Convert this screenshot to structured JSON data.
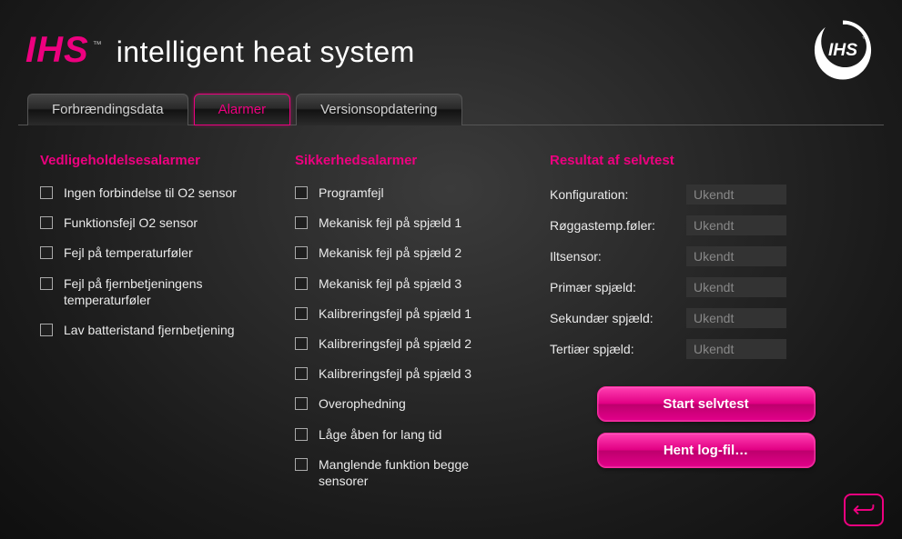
{
  "brand": {
    "ihs": "IHS",
    "tm": "™",
    "sub": "intelligent heat system"
  },
  "tabs": [
    {
      "label": "Forbrændingsdata",
      "active": false
    },
    {
      "label": "Alarmer",
      "active": true
    },
    {
      "label": "Versionsopdatering",
      "active": false
    }
  ],
  "maintenance": {
    "title": "Vedligeholdelsesalarmer",
    "items": [
      "Ingen forbindelse til O2 sensor",
      "Funktionsfejl O2 sensor",
      "Fejl på temperaturføler",
      "Fejl på fjernbetjeningens temperaturføler",
      "Lav batteristand fjernbetjening"
    ]
  },
  "safety": {
    "title": "Sikkerhedsalarmer",
    "items": [
      "Programfejl",
      "Mekanisk fejl på spjæld 1",
      "Mekanisk fejl på spjæld 2",
      "Mekanisk fejl på spjæld 3",
      "Kalibreringsfejl på spjæld 1",
      "Kalibreringsfejl på spjæld 2",
      "Kalibreringsfejl på spjæld 3",
      "Overophedning",
      "Låge åben for lang tid",
      "Manglende funktion begge sensorer"
    ]
  },
  "selftest": {
    "title": "Resultat af selvtest",
    "rows": [
      {
        "label": "Konfiguration:",
        "value": "Ukendt"
      },
      {
        "label": "Røggastemp.føler:",
        "value": "Ukendt"
      },
      {
        "label": "Iltsensor:",
        "value": "Ukendt"
      },
      {
        "label": "Primær spjæld:",
        "value": "Ukendt"
      },
      {
        "label": "Sekundær spjæld:",
        "value": "Ukendt"
      },
      {
        "label": "Tertiær spjæld:",
        "value": "Ukendt"
      }
    ],
    "buttons": {
      "start": "Start selvtest",
      "log": "Hent log-fil…"
    }
  }
}
